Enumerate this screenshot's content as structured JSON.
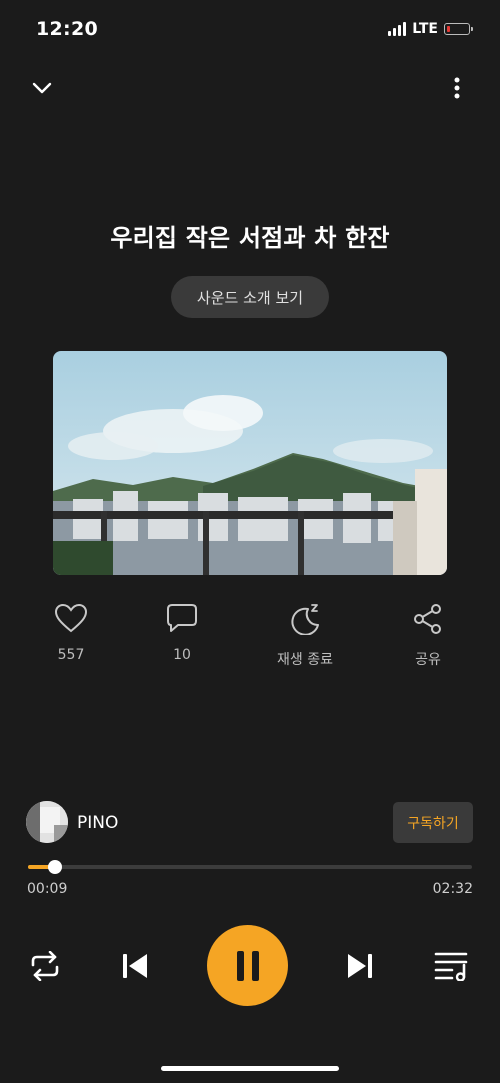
{
  "status_bar": {
    "time": "12:20",
    "network": "LTE",
    "battery_level": 0.15
  },
  "header": {
    "collapse_icon": "chevron-down-icon",
    "menu_icon": "more-vertical-icon"
  },
  "track": {
    "title": "우리집 작은 서점과 차 한잔",
    "intro_button": "사운드 소개 보기"
  },
  "actions": [
    {
      "id": "like",
      "icon": "heart-icon",
      "label": "557"
    },
    {
      "id": "comment",
      "icon": "comment-icon",
      "label": "10"
    },
    {
      "id": "sleep",
      "icon": "moon-sleep-icon",
      "label": "재생 종료"
    },
    {
      "id": "share",
      "icon": "share-icon",
      "label": "공유"
    }
  ],
  "artist": {
    "name": "PINO",
    "subscribe_label": "구독하기"
  },
  "player": {
    "current_time": "00:09",
    "total_time": "02:32",
    "progress": 0.06,
    "accent_color": "#f5a524",
    "controls": [
      "repeat-icon",
      "skip-previous-icon",
      "pause-icon",
      "skip-next-icon",
      "playlist-icon"
    ]
  }
}
